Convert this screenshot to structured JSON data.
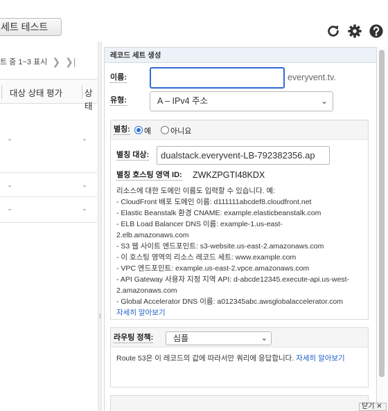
{
  "left": {
    "test_button": "세트 테스트",
    "pager_text": "트 중 1~3 표시",
    "pager_next": "❯",
    "pager_last": "❯|",
    "columns": [
      "대상 상태 평가",
      "상태"
    ],
    "rows": [
      {
        "c1": "-",
        "c2": "-"
      },
      {
        "c1": "-",
        "c2": "-"
      },
      {
        "c1": "-",
        "c2": "-"
      }
    ]
  },
  "top_icons": [
    "refresh-icon",
    "gear-icon",
    "help-icon"
  ],
  "panel": {
    "title": "레코드 세트 생성",
    "name_label": "이름:",
    "name_value": "",
    "domain_suffix": "everyvent.tv.",
    "type_label": "유형:",
    "type_value": "A – IPv4 주소",
    "alias": {
      "label": "별칭:",
      "yes": "예",
      "no": "아니요",
      "selected": "yes",
      "target_label": "별칭 대상:",
      "target_value": "dualstack.everyvent-LB-792382356.ap",
      "zone_label": "별칭 호스팅 영역 ID:",
      "zone_value": "ZWKZPGTI48KDX",
      "help_lines": [
        "리소스에 대한 도메인 이름도 입력할 수 있습니다. 예:",
        "- CloudFront 배포 도메인 이름: d111111abcdef8.cloudfront.net",
        "- Elastic Beanstalk 환경 CNAME: example.elasticbeanstalk.com",
        "- ELB Load Balancer DNS 이름: example-1.us-east-2.elb.amazonaws.com",
        "- S3 웹 사이트 엔드포인트: s3-website.us-east-2.amazonaws.com",
        "- 이 호스팅 영역의 리소스 레코드 세트: www.example.com",
        "- VPC 엔드포인트: example.us-east-2.vpce.amazonaws.com",
        "- API Gateway 사용자 지정 지역 API: d-abcde12345.execute-api.us-west-2.amazonaws.com",
        "- Global Accelerator DNS 이름: a012345abc.awsglobalaccelerator.com"
      ],
      "learn_more": "자세히 알아보기"
    },
    "routing": {
      "label": "라우팅 정책:",
      "value": "심플",
      "help": "Route 53은 이 레코드의 값에 따라서만 쿼리에 응답합니다.",
      "learn_more": "자세히 알아보기"
    },
    "close_label": "닫기"
  }
}
